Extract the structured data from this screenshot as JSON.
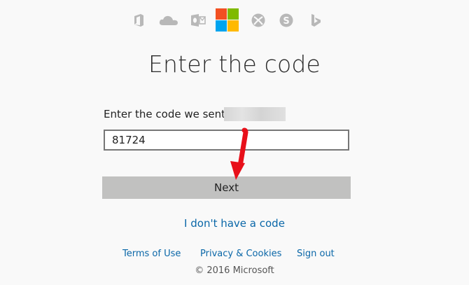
{
  "header": {
    "service_icons": [
      {
        "name": "office-icon",
        "color": "#b8b8b8"
      },
      {
        "name": "onedrive-icon",
        "color": "#b8b8b8"
      },
      {
        "name": "outlook-icon",
        "color": "#b8b8b8"
      },
      {
        "name": "microsoft-logo",
        "colors": [
          "#f25022",
          "#7fba00",
          "#00a4ef",
          "#ffb900"
        ]
      },
      {
        "name": "xbox-icon",
        "color": "#b8b8b8"
      },
      {
        "name": "skype-icon",
        "color": "#b8b8b8"
      },
      {
        "name": "bing-icon",
        "color": "#b8b8b8"
      }
    ]
  },
  "main": {
    "title": "Enter the code",
    "code_label": "Enter the code we sent to",
    "code_value": "81724",
    "next_label": "Next",
    "no_code_link": "I don't have a code"
  },
  "footer": {
    "terms": "Terms of Use",
    "privacy": "Privacy & Cookies",
    "signout": "Sign out",
    "copyright": "© 2016 Microsoft"
  },
  "colors": {
    "link": "#0a67a8",
    "button": "#c1c1c0",
    "annotation_arrow": "#e8101a"
  }
}
